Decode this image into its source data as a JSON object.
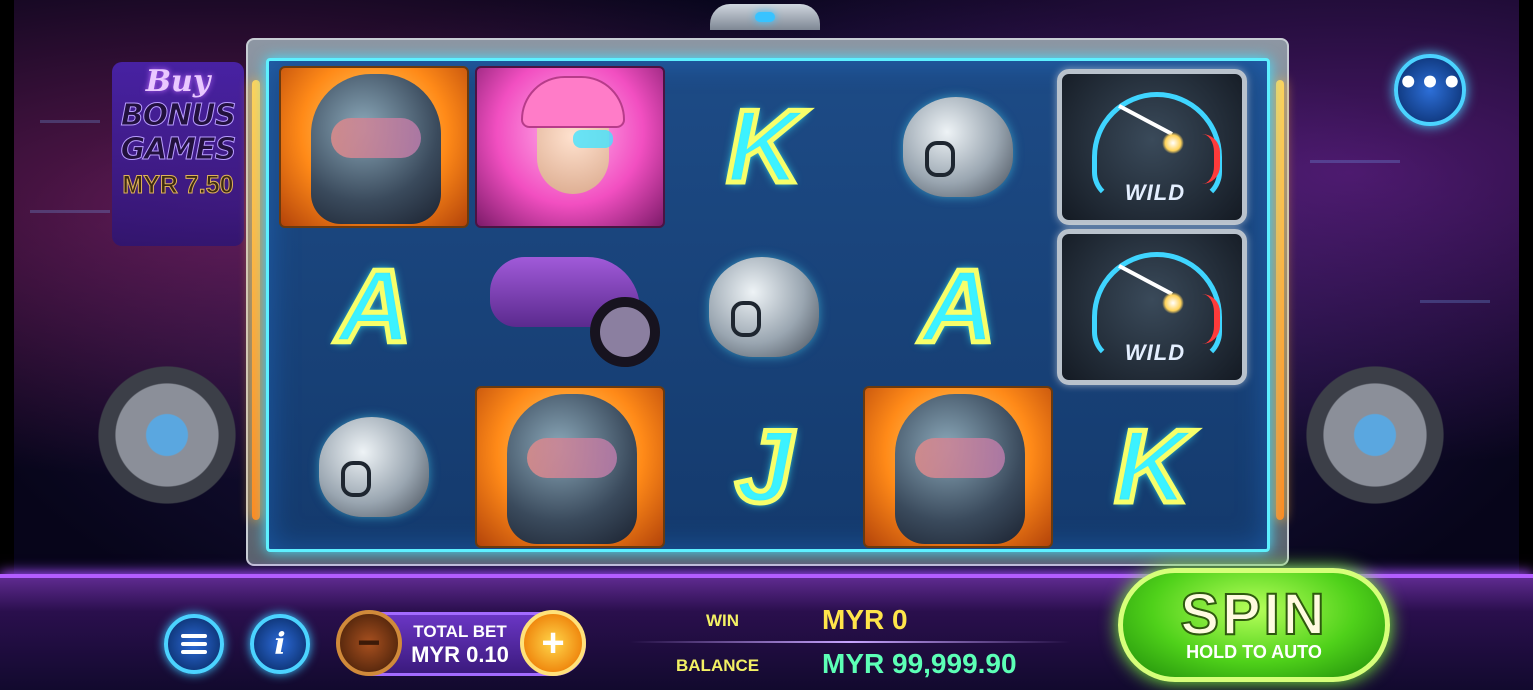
{
  "buy_bonus": {
    "line1": "Buy",
    "line2": "BONUS",
    "line3": "GAMES",
    "price": "MYR 7.50"
  },
  "reels": {
    "row1": [
      "rider-orange",
      "rider-pink",
      "K",
      "pod",
      "WILD"
    ],
    "row2": [
      "A",
      "bike",
      "pod",
      "A",
      "WILD"
    ],
    "row3": [
      "pod",
      "rider-orange",
      "J",
      "rider-orange",
      "K"
    ],
    "letters": {
      "K": "K",
      "A": "A",
      "J": "J"
    },
    "wild_label": "WILD"
  },
  "menu": {
    "dots": "•••"
  },
  "bottom": {
    "total_bet_label": "TOTAL BET",
    "total_bet_value": "MYR 0.10",
    "minus": "−",
    "plus": "+",
    "info": "i",
    "win_label": "WIN",
    "win_value": "MYR 0",
    "balance_label": "BALANCE",
    "balance_value": "MYR 99,999.90",
    "spin_label": "SPIN",
    "spin_sub": "HOLD TO AUTO"
  },
  "colors": {
    "accent_cyan": "#4bd3ff",
    "spin_green": "#4fd11a",
    "win_yellow": "#ffe54a",
    "balance_green": "#5cffb6",
    "bar_purple": "#b35dff"
  }
}
